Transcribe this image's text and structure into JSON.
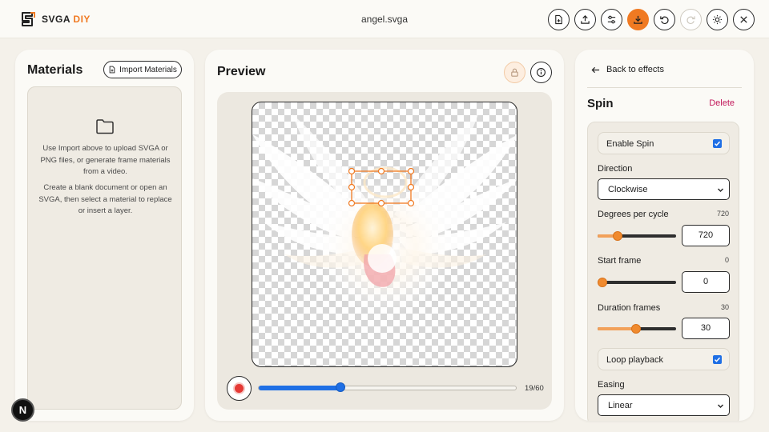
{
  "app": {
    "logo_text_main": "SVGA",
    "logo_text_accent": "DIY",
    "filename": "angel.svga"
  },
  "toolbar": {
    "buttons": [
      {
        "name": "new-file-button",
        "icon": "file-plus-icon"
      },
      {
        "name": "upload-button",
        "icon": "upload-icon"
      },
      {
        "name": "settings-sliders-button",
        "icon": "sliders-icon"
      },
      {
        "name": "download-button",
        "icon": "download-icon",
        "state": "primary"
      },
      {
        "name": "undo-button",
        "icon": "undo-icon"
      },
      {
        "name": "redo-button",
        "icon": "redo-icon",
        "state": "disabled"
      },
      {
        "name": "theme-toggle-button",
        "icon": "sun-icon"
      },
      {
        "name": "close-button",
        "icon": "close-icon"
      }
    ],
    "accent_color": "#f07a22"
  },
  "materials": {
    "title": "Materials",
    "import_label": "Import Materials",
    "empty_text_1": "Use Import above to upload SVGA or PNG files, or generate frame materials from a video.",
    "empty_text_2": "Create a blank document or open an SVGA, then select a material to replace or insert a layer."
  },
  "preview": {
    "title": "Preview",
    "frame_current": 19,
    "frame_total": 60,
    "frame_label": "19/60",
    "timeline_color": "#1f6fe5"
  },
  "effects": {
    "back_label": "Back to effects",
    "effect_title": "Spin",
    "delete_label": "Delete",
    "enable_label": "Enable Spin",
    "enable_checked": true,
    "direction_label": "Direction",
    "direction_value": "Clockwise",
    "degrees_label": "Degrees per cycle",
    "degrees_value": "720",
    "start_label": "Start frame",
    "start_value": "0",
    "duration_label": "Duration frames",
    "duration_value": "30",
    "loop_label": "Loop playback",
    "loop_checked": true,
    "easing_label": "Easing",
    "easing_value": "Linear",
    "slider_levels": {
      "degrees": 0.22,
      "start": 0.0,
      "duration": 0.49
    }
  },
  "badge": {
    "label": "N"
  }
}
